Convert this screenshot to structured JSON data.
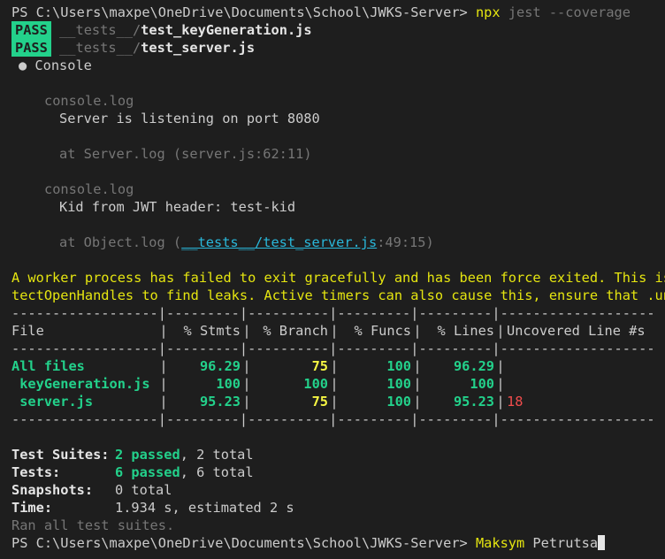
{
  "prompt": {
    "path": "PS C:\\Users\\maxpe\\OneDrive\\Documents\\School\\JWKS-Server> ",
    "command": "npx",
    "args": " jest --coverage"
  },
  "results": [
    {
      "badge": "PASS",
      "dir": "__tests__/",
      "file": "test_keyGeneration.js"
    },
    {
      "badge": "PASS",
      "dir": "__tests__/",
      "file": "test_server.js"
    }
  ],
  "console": {
    "header": "● Console",
    "logs": [
      {
        "type": "console.log",
        "message": "Server is listening on port 8080",
        "at_prefix": "at Server.log (",
        "at_link": "",
        "at_loc": "server.js:62:11",
        "at_suffix": ")"
      },
      {
        "type": "console.log",
        "message": "Kid from JWT header: test-kid",
        "at_prefix": "at Object.log (",
        "at_link": "__tests__/test_server.js",
        "at_loc": ":49:15",
        "at_suffix": ")"
      }
    ]
  },
  "warning": {
    "line1": "A worker process has failed to exit gracefully and has been force exited. This is",
    "line2": "tectOpenHandles to find leaks. Active timers can also cause this, ensure that .unr"
  },
  "coverage": {
    "separator": "------------------|---------|----------|---------|---------|-------------------",
    "headers": [
      "File",
      "% Stmts",
      "% Branch",
      "% Funcs",
      "% Lines",
      "Uncovered Line #s"
    ],
    "rows": [
      {
        "file": "All files",
        "stmts": "96.29",
        "branch": "75",
        "funcs": "100",
        "lines": "96.29",
        "uncovered": ""
      },
      {
        "file": " keyGeneration.js",
        "stmts": "100",
        "branch": "100",
        "funcs": "100",
        "lines": "100",
        "uncovered": ""
      },
      {
        "file": " server.js",
        "stmts": "95.23",
        "branch": "75",
        "funcs": "100",
        "lines": "95.23",
        "uncovered": "18"
      }
    ]
  },
  "summary": {
    "suites_label": "Test Suites:",
    "suites_passed": "2 passed",
    "suites_total": ", 2 total",
    "tests_label": "Tests:",
    "tests_passed": "6 passed",
    "tests_total": ", 6 total",
    "snapshots_label": "Snapshots:",
    "snapshots_value": "0 total",
    "time_label": "Time:",
    "time_value": "1.934 s, estimated 2 s",
    "ran": "Ran all test suites."
  },
  "final_prompt": {
    "path": "PS C:\\Users\\maxpe\\OneDrive\\Documents\\School\\JWKS-Server> ",
    "typed_command": "Maksym",
    "typed_rest": " Petrutsa"
  },
  "colors": {
    "background": "#1e1e1e",
    "pass_badge": "#23d18b",
    "yellow": "#e5e510",
    "red": "#f14c4c",
    "link": "#29b8db"
  }
}
